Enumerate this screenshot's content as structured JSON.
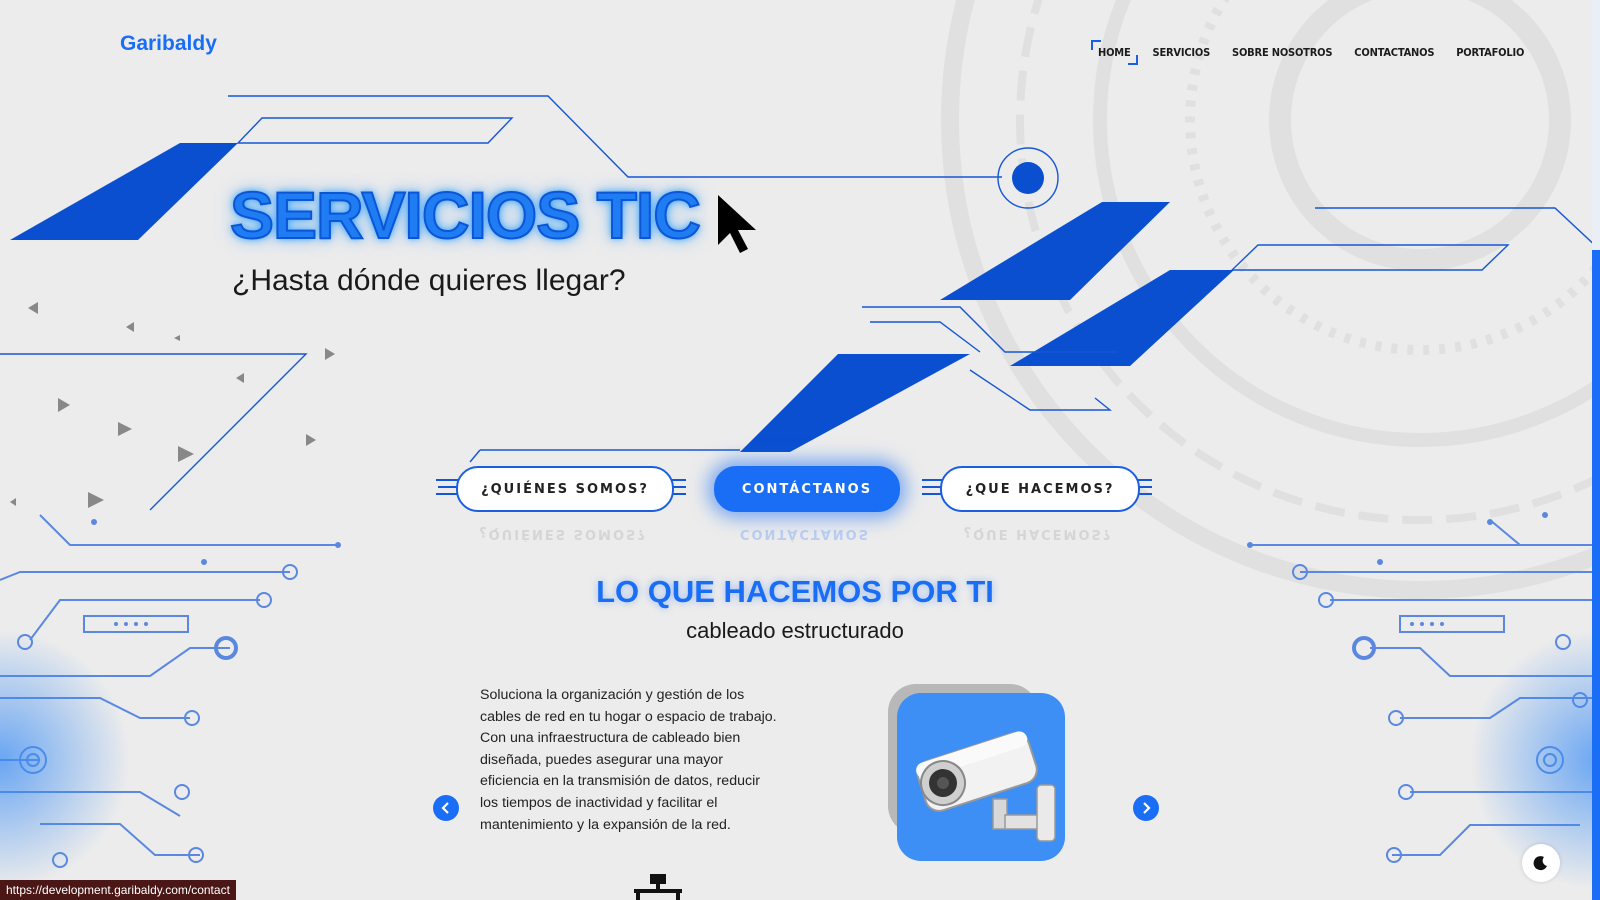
{
  "brand": {
    "name": "Garibaldy",
    "accent": "#1a6ef5"
  },
  "nav": {
    "items": [
      {
        "label": "HOME",
        "active": true
      },
      {
        "label": "SERVICIOS"
      },
      {
        "label": "SOBRE NOSOTROS"
      },
      {
        "label": "CONTACTANOS"
      },
      {
        "label": "PORTAFOLIO"
      }
    ]
  },
  "hero": {
    "title": "SERVICIOS TIC",
    "subtitle": "¿Hasta dónde quieres llegar?"
  },
  "buttons": {
    "about": "¿QUIÉNES SOMOS?",
    "contact": "CONTÁCTANOS",
    "what": "¿QUE HACEMOS?"
  },
  "section": {
    "title": "LO QUE HACEMOS POR TI",
    "subtitle": "cableado estructurado",
    "description": "Soluciona la organización y gestión de los cables de red en tu hogar o espacio de trabajo. Con una infraestructura de cableado bien diseñada, puedes asegurar una mayor eficiencia en la transmisión de datos, reducir los tiempos de inactividad y facilitar el mantenimiento y la expansión de la red."
  },
  "status_url": "https://development.garibaldy.com/contact",
  "icons": [
    "cursor-icon",
    "chevron-left-icon",
    "chevron-right-icon",
    "security-camera-icon",
    "network-icon",
    "moon-icon"
  ]
}
